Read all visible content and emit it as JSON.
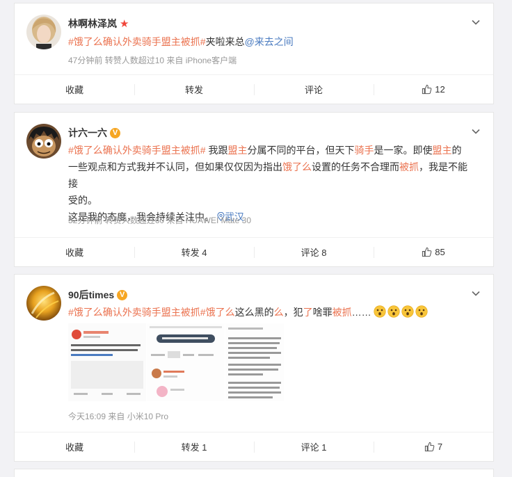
{
  "posts": [
    {
      "user": {
        "name": "林啊林泽岚",
        "badge": "star"
      },
      "content": {
        "topic": "#饿了么确认外卖骑手盟主被抓#",
        "text": "夹啦来总",
        "mention": "@来去之间"
      },
      "meta": {
        "time": "47分钟前",
        "reposts": "转赞人数超过10",
        "source": "来自 iPhone客户端"
      },
      "actions": {
        "collect": "收藏",
        "repost": "转发",
        "comment": "评论",
        "like": "12"
      }
    },
    {
      "user": {
        "name": "计六一六",
        "badge": "v"
      },
      "content": {
        "topic": "#饿了么确认外卖骑手盟主被抓#",
        "p1": " 我跟",
        "h1": "盟主",
        "p2": "分属不同的平台，但天下",
        "h2": "骑手",
        "p3": "是一家。即使",
        "h3": "盟主",
        "p4": "的",
        "line2": "一些观点和方式我并不认同，但如果仅仅因为指出",
        "h4": "饿了么",
        "p5": "设置的任务不合理而",
        "h5": "被抓",
        "p6": "，我是不能接",
        "line3": "受的。",
        "line4": "这是我的态度，我会持续关注中。",
        "location": "武汉"
      },
      "meta": {
        "time": "52分钟前",
        "reposts": "转赞人数超过60",
        "source": "来自 HUAWEI Mate 30"
      },
      "actions": {
        "collect": "收藏",
        "repost": "转发 4",
        "comment": "评论 8",
        "like": "85"
      }
    },
    {
      "user": {
        "name": "90后times",
        "badge": "v"
      },
      "content": {
        "topic": "#饿了么确认外卖骑手盟主被抓#",
        "h1": "饿了么",
        "p1": "这么",
        "p2": "黑的",
        "h2": "么",
        "p3": "，犯",
        "h3": "了",
        "p4": "啥罪",
        "h4": "被抓",
        "p5": "……"
      },
      "meta": {
        "time": "今天16:09",
        "source": "来自 小米10 Pro"
      },
      "actions": {
        "collect": "收藏",
        "repost": "转发 1",
        "comment": "评论 1",
        "like": "7"
      }
    }
  ],
  "icons": {
    "chevron": "chevron-down-icon",
    "like": "thumb-up-icon",
    "location": "location-pin-icon",
    "emoji": "shocked-face-emoji"
  },
  "colors": {
    "topic": "#eb7350",
    "link": "#4a7bc0",
    "meta": "#999999",
    "background": "#f2f2f5"
  }
}
